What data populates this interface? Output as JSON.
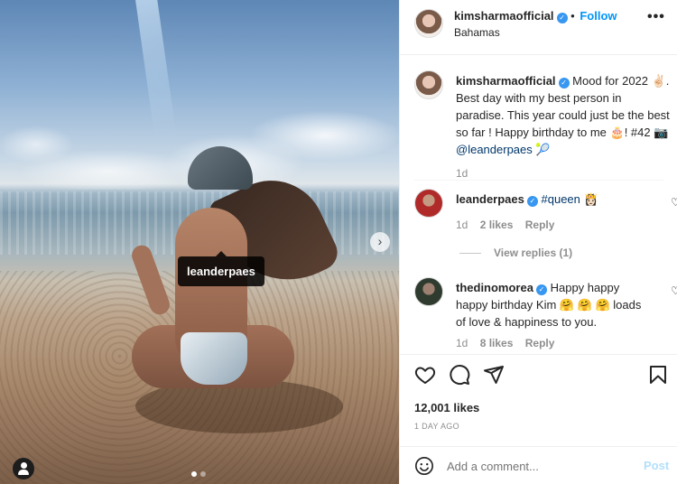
{
  "photo": {
    "tag_label": "leanderpaes",
    "carousel": {
      "count": 2,
      "active": 1
    }
  },
  "header": {
    "username": "kimsharmaofficial",
    "verified": true,
    "separator": "•",
    "follow_label": "Follow",
    "location": "Bahamas",
    "more": "•••"
  },
  "caption": {
    "username": "kimsharmaofficial",
    "text_1": "Mood for 2022 ✌🏻. Best day with my best person in paradise. This year could just be the best so far ! Happy birthday to me 🎂! #42",
    "camera": "📷",
    "mention": "@leanderpaes",
    "tail": "🎾",
    "time": "1d"
  },
  "comments": [
    {
      "username": "leanderpaes",
      "hashtag": "#queen",
      "emoji": "👸🏻",
      "time": "1d",
      "likes": "2 likes",
      "reply": "Reply",
      "view_replies": "View replies (1)"
    },
    {
      "username": "thedinomorea",
      "text": "Happy happy happy birthday Kim 🤗 🤗 🤗 loads of love & happiness to you.",
      "time": "1d",
      "likes": "8 likes",
      "reply": "Reply"
    }
  ],
  "stats": {
    "likes": "12,001 likes",
    "ago": "1 DAY AGO"
  },
  "add_comment": {
    "placeholder": "Add a comment...",
    "post_label": "Post"
  },
  "colors": {
    "link_blue": "#0095f6",
    "verified_blue": "#3897f0",
    "post_disabled": "#b2dffc",
    "muted": "#8e8e8e"
  }
}
